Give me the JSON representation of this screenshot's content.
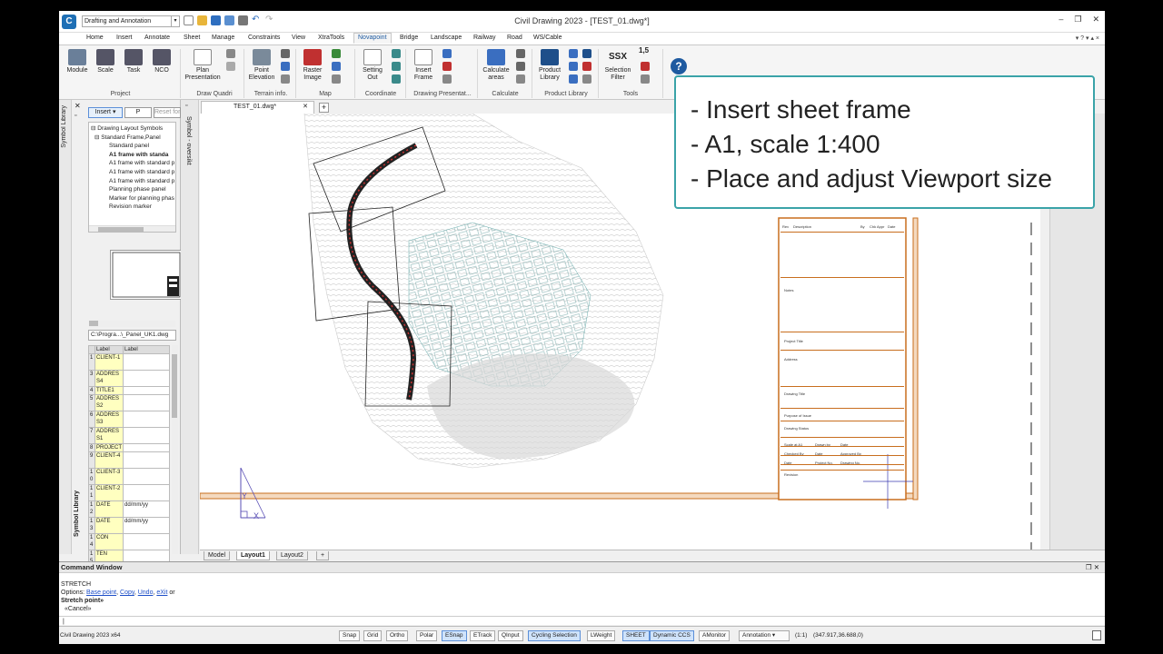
{
  "app": {
    "title": "Civil Drawing 2023 - [TEST_01.dwg*]",
    "workspace": "Drafting and Annotation",
    "version_text": "Civil Drawing 2023 x64"
  },
  "ribbon": {
    "tabs": [
      "Home",
      "Insert",
      "Annotate",
      "Sheet",
      "Manage",
      "Constraints",
      "View",
      "XtraTools",
      "Novapoint",
      "Bridge",
      "Landscape",
      "Railway",
      "Road",
      "WS/Cable"
    ],
    "active_tab": "Novapoint",
    "tab_controls": "▾ ? ▾ ▴ ×",
    "buttons": {
      "module": "Module",
      "scale": "Scale",
      "task": "Task",
      "nco": "NCO",
      "plan_presentation_1": "Plan",
      "plan_presentation_2": "Presentation",
      "point_elevation_1": "Point",
      "point_elevation_2": "Elevation",
      "raster_image_1": "Raster",
      "raster_image_2": "Image",
      "setting_out_1": "Setting",
      "setting_out_2": "Out",
      "insert_frame_1": "Insert",
      "insert_frame_2": "Frame",
      "calculate_areas_1": "Calculate",
      "calculate_areas_2": "areas",
      "product_library_1": "Product",
      "product_library_2": "Library",
      "selection_filter_1": "Selection",
      "selection_filter_2": "Filter",
      "ssx": "SSX",
      "scale_value": "1,5"
    },
    "groups": [
      "Project",
      "Draw Quadri",
      "Terrain info.",
      "Map",
      "Coordinate",
      "Drawing Presentat...",
      "Calculate",
      "Product Library",
      "Tools"
    ]
  },
  "symbol_library": {
    "strip_label": "Symbol Library",
    "side_label": "Symbol Library",
    "insert_button": "Insert",
    "p_button": "P",
    "reset_button": "Reset font",
    "tree": [
      "⊟ Drawing Layout Symbols",
      "  ⊟ Standard Frame,Panel",
      "Standard panel",
      "A1 frame with standa",
      "A1 frame with standard p",
      "A1 frame with standard p",
      "A1 frame with standard p",
      "Planning phase panel",
      "Marker for planning phas",
      "Revision marker"
    ],
    "file_path": "C:\\Progra...\\_Panel_UK1.dwg",
    "table_headers": [
      "",
      "Label",
      "Label"
    ],
    "table_rows": [
      [
        "1",
        "CLIENT-1",
        ""
      ],
      [
        "3",
        "ADDRES S4",
        ""
      ],
      [
        "4",
        "TITLE1",
        ""
      ],
      [
        "5",
        "ADDRES S2",
        ""
      ],
      [
        "6",
        "ADDRES S3",
        ""
      ],
      [
        "7",
        "ADDRES S1",
        ""
      ],
      [
        "8",
        "PROJECT",
        ""
      ],
      [
        "9",
        "CLIENT-4",
        ""
      ],
      [
        "1 0",
        "CLIENT-3",
        ""
      ],
      [
        "1 1",
        "CLIENT-2",
        ""
      ],
      [
        "1 2",
        "DATE",
        "dd/mm/yy"
      ],
      [
        "1 3",
        "DATE",
        "dd/mm/yy"
      ],
      [
        "1 4",
        "CON",
        ""
      ],
      [
        "1 5",
        "TEN",
        ""
      ]
    ]
  },
  "oversikt_label": "Symbol - oversikt",
  "document": {
    "tab": "TEST_01.dwg*",
    "layout_tabs": [
      "Model",
      "Layout1",
      "Layout2"
    ],
    "active_layout": "Layout1"
  },
  "title_block": {
    "labels": [
      "Rev",
      "Description",
      "By",
      "Chk",
      "Appr",
      "Date",
      "Notes",
      "Project Title",
      "Address",
      "Drawing Title",
      "Purpose of Issue",
      "Drawing Status",
      "Scale at A1",
      "Drawn by",
      "Date",
      "Checked By",
      "Date",
      "Approved By",
      "Date",
      "Project No.",
      "Drawing No.",
      "Revision"
    ]
  },
  "command_window": {
    "title": "Command Window",
    "line1": "STRETCH",
    "options_prefix": "Options:",
    "options": [
      "Base point",
      "Copy",
      "Undo",
      "eXit"
    ],
    "options_suffix": "or",
    "line3": "Stretch point»",
    "line4": "«Cancel»",
    "prompt": "|"
  },
  "status_bar": {
    "toggles": [
      {
        "label": "Snap",
        "on": false
      },
      {
        "label": "Grid",
        "on": false
      },
      {
        "label": "Ortho",
        "on": false
      },
      {
        "label": "Polar",
        "on": false
      },
      {
        "label": "ESnap",
        "on": true
      },
      {
        "label": "ETrack",
        "on": false
      },
      {
        "label": "QInput",
        "on": false
      },
      {
        "label": "Cycling Selection",
        "on": true
      },
      {
        "label": "LWeight",
        "on": false
      },
      {
        "label": "SHEET",
        "on": true
      },
      {
        "label": "Dynamic CCS",
        "on": true
      },
      {
        "label": "AMonitor",
        "on": false
      }
    ],
    "annotation": "Annotation",
    "scale": "(1:1)",
    "coords": "(347.917,36.688,0)"
  },
  "overlay_note": {
    "lines": [
      "- Insert sheet frame",
      "- A1, scale 1:400",
      "- Place and adjust Viewport size"
    ]
  },
  "colors": {
    "accent": "#1e6fb5",
    "frame": "#c86e1e",
    "note_border": "#3aa3a8"
  }
}
